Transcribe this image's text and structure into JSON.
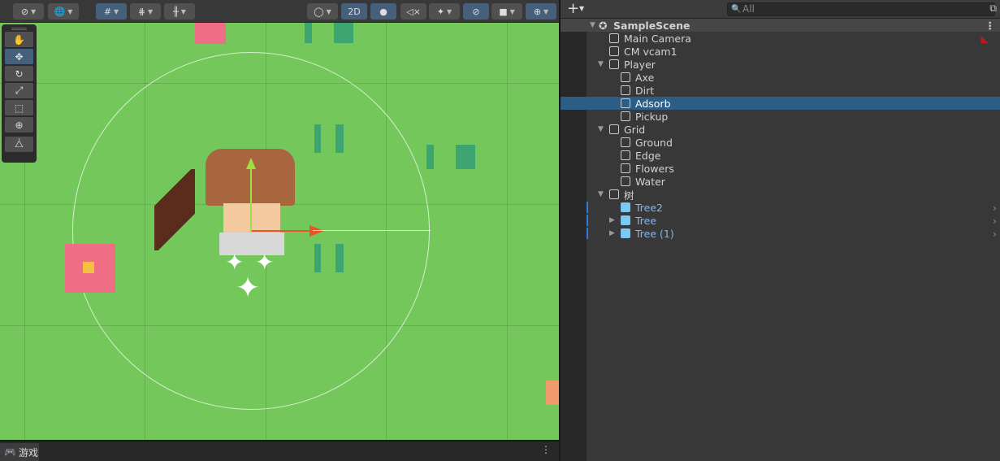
{
  "toolbar": {
    "mode_2d": "2D"
  },
  "game_tab": {
    "label": "游戏"
  },
  "hierarchy": {
    "add_label": "+",
    "search_placeholder": "All",
    "scene": "SampleScene",
    "items": [
      {
        "label": "Main Camera",
        "depth": 1
      },
      {
        "label": "CM vcam1",
        "depth": 1
      },
      {
        "label": "Player",
        "depth": 1,
        "expanded": true
      },
      {
        "label": "Axe",
        "depth": 2
      },
      {
        "label": "Dirt",
        "depth": 2
      },
      {
        "label": "Adsorb",
        "depth": 2,
        "selected": true
      },
      {
        "label": "Pickup",
        "depth": 2
      },
      {
        "label": "Grid",
        "depth": 1,
        "expanded": true
      },
      {
        "label": "Ground",
        "depth": 2
      },
      {
        "label": "Edge",
        "depth": 2
      },
      {
        "label": "Flowers",
        "depth": 2
      },
      {
        "label": "Water",
        "depth": 2
      },
      {
        "label": "树",
        "depth": 1,
        "expanded": true
      },
      {
        "label": "Tree2",
        "depth": 2,
        "prefab": true
      },
      {
        "label": "Tree",
        "depth": 2,
        "prefab": true,
        "collapsed": true
      },
      {
        "label": "Tree (1)",
        "depth": 2,
        "prefab": true,
        "collapsed": true
      }
    ]
  },
  "colors": {
    "grass": "#74c85b",
    "selection": "#2c5d87",
    "prefab": "#7fb8f5",
    "toggle_on": "#46607c"
  }
}
